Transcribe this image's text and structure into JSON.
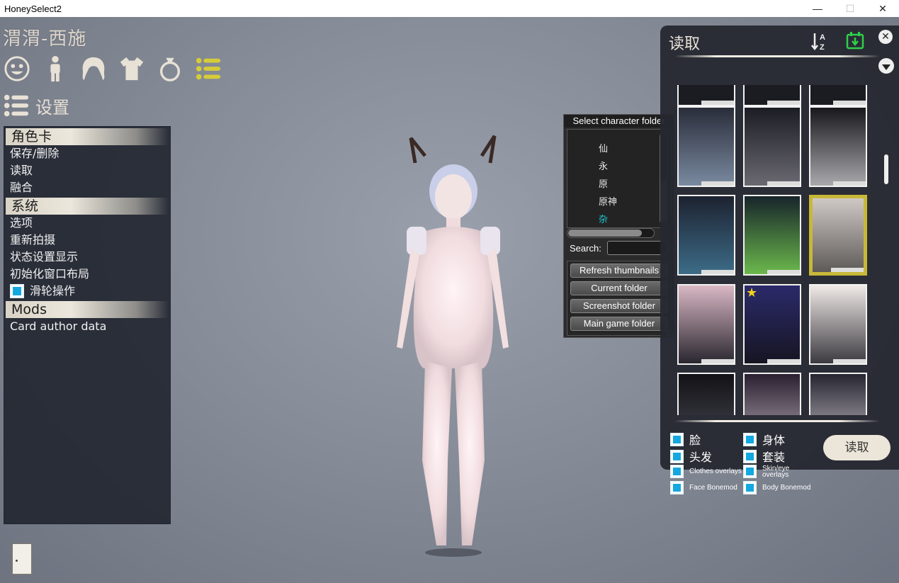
{
  "window": {
    "title": "HoneySelect2",
    "controls": {
      "minimize": "—",
      "maximize": "☐",
      "close": "✕"
    }
  },
  "character_name": "渭渭-西施",
  "category_icons": [
    "face-icon",
    "body-icon",
    "hair-icon",
    "clothes-icon",
    "accessory-icon",
    "settings-list-icon"
  ],
  "settings_header": {
    "label": "设置"
  },
  "left_menu": {
    "sections": [
      {
        "title": "角色卡",
        "items": [
          "保存/删除",
          "读取",
          "融合"
        ]
      },
      {
        "title": "系统",
        "items": [
          "选项",
          "重新拍摄",
          "状态设置显示",
          "初始化窗口布局"
        ],
        "checkbox_item": {
          "label": "滑轮操作",
          "checked": true
        }
      },
      {
        "title": "Mods",
        "items": [
          "Card author data"
        ]
      }
    ]
  },
  "folder_panel": {
    "title": "Select character folder",
    "folders": [
      "仙",
      "永",
      "原",
      "原神",
      "杂"
    ],
    "selected_folder": "杂",
    "search_label": "Search:",
    "search_value": "",
    "buttons": [
      "Refresh thumbnails",
      "Current folder",
      "Screenshot folder",
      "Main game folder"
    ]
  },
  "load_panel": {
    "title": "读取",
    "sort_icon": "sort-az-icon",
    "date_icon": "calendar-download-icon",
    "cards_selected_index": 5,
    "load_options": [
      {
        "label": "脸",
        "checked": true
      },
      {
        "label": "身体",
        "checked": true
      },
      {
        "label": "头发",
        "checked": true
      },
      {
        "label": "套装",
        "checked": true
      },
      {
        "label": "Clothes overlays",
        "checked": true
      },
      {
        "label": "Skin/eye overlays",
        "checked": true
      },
      {
        "label": "Face Bonemod",
        "checked": true
      },
      {
        "label": "Body Bonemod",
        "checked": true
      }
    ],
    "load_button": "读取"
  },
  "colors": {
    "accent_checkbox": "#14a8e0",
    "selected_card_border": "#c8b838",
    "selected_folder_text": "#1ec8d0",
    "date_icon": "#2fd04a"
  }
}
